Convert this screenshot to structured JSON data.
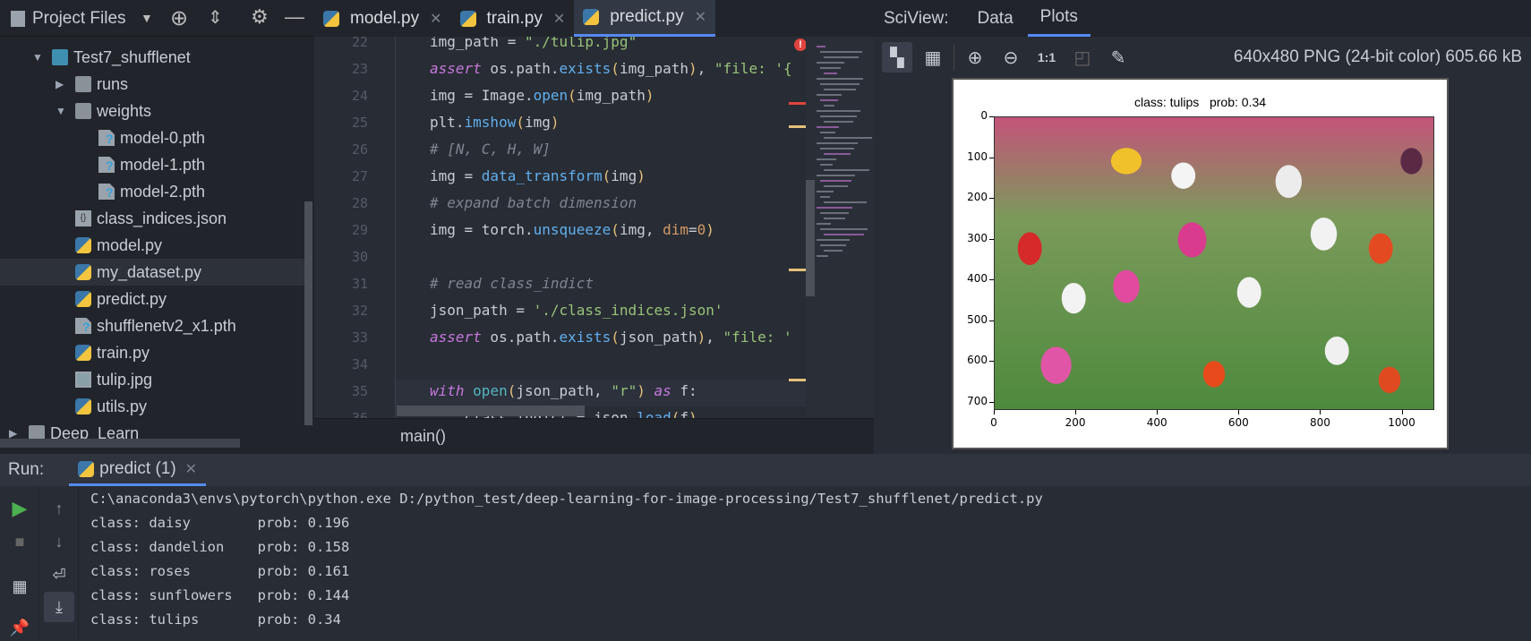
{
  "project_panel": {
    "title": "Project Files",
    "icons": [
      "crosshair-icon",
      "collapse-icon",
      "gear-icon",
      "minimize-icon"
    ]
  },
  "tree": [
    {
      "label": "Test7_shufflenet",
      "type": "folder-module",
      "arrow": "down",
      "level": 2
    },
    {
      "label": "runs",
      "type": "folder",
      "arrow": "right",
      "level": 3
    },
    {
      "label": "weights",
      "type": "folder",
      "arrow": "down",
      "level": 3
    },
    {
      "label": "model-0.pth",
      "type": "unknown",
      "level": 4
    },
    {
      "label": "model-1.pth",
      "type": "unknown",
      "level": 4
    },
    {
      "label": "model-2.pth",
      "type": "unknown",
      "level": 4
    },
    {
      "label": "class_indices.json",
      "type": "json",
      "level": 3
    },
    {
      "label": "model.py",
      "type": "python",
      "level": 3
    },
    {
      "label": "my_dataset.py",
      "type": "python",
      "level": 3,
      "selected": true
    },
    {
      "label": "predict.py",
      "type": "python",
      "level": 3
    },
    {
      "label": "shufflenetv2_x1.pth",
      "type": "unknown",
      "level": 3
    },
    {
      "label": "train.py",
      "type": "python",
      "level": 3
    },
    {
      "label": "tulip.jpg",
      "type": "image",
      "level": 3
    },
    {
      "label": "utils.py",
      "type": "python",
      "level": 3
    },
    {
      "label": "Deep_Learn",
      "type": "folder",
      "arrow": "right",
      "level": 1
    }
  ],
  "editor_tabs": [
    {
      "label": "model.py",
      "active": false
    },
    {
      "label": "train.py",
      "active": false
    },
    {
      "label": "predict.py",
      "active": true
    }
  ],
  "code_lines": [
    {
      "n": "22",
      "tokens": [
        [
          "",
          "img_path = "
        ],
        [
          "st",
          "\"./tulip.jpg\""
        ]
      ]
    },
    {
      "n": "23",
      "tokens": [
        [
          "kw",
          "assert"
        ],
        [
          "",
          " os.path."
        ],
        [
          "fn",
          "exists"
        ],
        [
          "pa",
          "("
        ],
        [
          "",
          "img_path"
        ],
        [
          "pa",
          ")"
        ],
        [
          "",
          ", "
        ],
        [
          "st",
          "\"file: '{"
        ]
      ]
    },
    {
      "n": "24",
      "tokens": [
        [
          "",
          "img = Image."
        ],
        [
          "fn",
          "open"
        ],
        [
          "pa",
          "("
        ],
        [
          "",
          "img_path"
        ],
        [
          "pa",
          ")"
        ]
      ]
    },
    {
      "n": "25",
      "tokens": [
        [
          "",
          "plt."
        ],
        [
          "fn",
          "imshow"
        ],
        [
          "pa",
          "("
        ],
        [
          "",
          "img"
        ],
        [
          "pa",
          ")"
        ]
      ]
    },
    {
      "n": "26",
      "tokens": [
        [
          "cm",
          "# [N, C, H, W]"
        ]
      ]
    },
    {
      "n": "27",
      "tokens": [
        [
          "",
          "img = "
        ],
        [
          "fn",
          "data_transform"
        ],
        [
          "pa",
          "("
        ],
        [
          "",
          "img"
        ],
        [
          "pa",
          ")"
        ]
      ]
    },
    {
      "n": "28",
      "tokens": [
        [
          "cm",
          "# expand batch dimension"
        ]
      ]
    },
    {
      "n": "29",
      "tokens": [
        [
          "",
          "img = torch."
        ],
        [
          "fn",
          "unsqueeze"
        ],
        [
          "pa",
          "("
        ],
        [
          "",
          "img, "
        ],
        [
          "nu",
          "dim"
        ],
        [
          "",
          "="
        ],
        [
          "nu",
          "0"
        ],
        [
          "pa",
          ")"
        ]
      ]
    },
    {
      "n": "30",
      "tokens": []
    },
    {
      "n": "31",
      "tokens": [
        [
          "cm",
          "# read class_indict"
        ]
      ]
    },
    {
      "n": "32",
      "tokens": [
        [
          "",
          "json_path = "
        ],
        [
          "st",
          "'./class_indices.json'"
        ]
      ]
    },
    {
      "n": "33",
      "tokens": [
        [
          "kw",
          "assert"
        ],
        [
          "",
          " os.path."
        ],
        [
          "fn",
          "exists"
        ],
        [
          "pa",
          "("
        ],
        [
          "",
          "json_path"
        ],
        [
          "pa",
          ")"
        ],
        [
          "",
          ", "
        ],
        [
          "st",
          "\"file: '"
        ]
      ]
    },
    {
      "n": "34",
      "tokens": []
    },
    {
      "n": "35",
      "tokens": [
        [
          "kw",
          "with"
        ],
        [
          "",
          " "
        ],
        [
          "bi",
          "open"
        ],
        [
          "pa",
          "("
        ],
        [
          "",
          "json_path, "
        ],
        [
          "st",
          "\"r\""
        ],
        [
          "pa",
          ")"
        ],
        [
          "",
          " "
        ],
        [
          "kw",
          "as"
        ],
        [
          "",
          " f:"
        ]
      ]
    },
    {
      "n": "36",
      "tokens": [
        [
          "",
          "    class_indict = json."
        ],
        [
          "fn",
          "load"
        ],
        [
          "pa",
          "("
        ],
        [
          "",
          "f"
        ],
        [
          "pa",
          ")"
        ]
      ]
    },
    {
      "n": "37",
      "tokens": []
    }
  ],
  "breadcrumb": "main()",
  "sciview": {
    "label": "SciView:",
    "tabs": [
      {
        "label": "Data",
        "active": false
      },
      {
        "label": "Plots",
        "active": true
      }
    ],
    "image_info": "640x480 PNG (24-bit color) 605.66 kB",
    "tools": [
      "transparency-icon",
      "grid-icon",
      "zoom-in-icon",
      "zoom-out-icon",
      "actual-size-icon",
      "fit-icon",
      "color-picker-icon"
    ],
    "actual_size_label": "1:1"
  },
  "plot": {
    "title": "class: tulips   prob: 0.34",
    "xticks": [
      "0",
      "200",
      "400",
      "600",
      "800",
      "1000"
    ],
    "yticks": [
      "0",
      "100",
      "200",
      "300",
      "400",
      "500",
      "600",
      "700"
    ]
  },
  "run": {
    "label": "Run:",
    "tab": "predict (1)"
  },
  "console": [
    "C:\\anaconda3\\envs\\pytorch\\python.exe D:/python_test/deep-learning-for-image-processing/Test7_shufflenet/predict.py",
    "class: daisy        prob: 0.196",
    "class: dandelion    prob: 0.158",
    "class: roses        prob: 0.161",
    "class: sunflowers   prob: 0.144",
    "class: tulips       prob: 0.34"
  ],
  "colors": {
    "accent": "#568af2",
    "run": "#4caf50"
  }
}
